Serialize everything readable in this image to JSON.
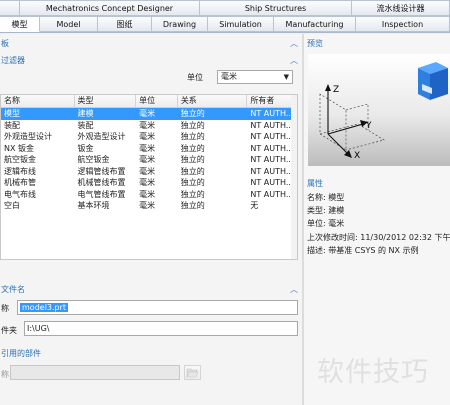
{
  "top_tabs": [
    {
      "label": "",
      "width": 0
    },
    {
      "label": "Mechatronics Concept Designer"
    },
    {
      "label": "Ship Structures"
    },
    {
      "label": "流水线设计器"
    }
  ],
  "app_tabs": [
    {
      "label": "模型",
      "active": true
    },
    {
      "label": "Model"
    },
    {
      "label": "图纸"
    },
    {
      "label": "Drawing"
    },
    {
      "label": "Simulation"
    },
    {
      "label": "Manufacturing"
    },
    {
      "label": "Inspection"
    }
  ],
  "templates": {
    "header": "板",
    "filter_header": "过滤器",
    "unit_label": "单位",
    "unit_value": "毫米",
    "columns": [
      "名称",
      "类型",
      "单位",
      "关系",
      "所有者"
    ],
    "rows": [
      [
        "模型",
        "建模",
        "毫米",
        "独立的",
        "NT AUTH..."
      ],
      [
        "装配",
        "装配",
        "毫米",
        "独立的",
        "NT AUTH..."
      ],
      [
        "外观造型设计",
        "外观造型设计",
        "毫米",
        "独立的",
        "NT AUTH..."
      ],
      [
        "NX 钣金",
        "钣金",
        "毫米",
        "独立的",
        "NT AUTH..."
      ],
      [
        "航空钣金",
        "航空钣金",
        "毫米",
        "独立的",
        "NT AUTH..."
      ],
      [
        "逻辑布线",
        "逻辑管线布置",
        "毫米",
        "独立的",
        "NT AUTH..."
      ],
      [
        "机械布管",
        "机械管线布置",
        "毫米",
        "独立的",
        "NT AUTH..."
      ],
      [
        "电气布线",
        "电气管线布置",
        "毫米",
        "独立的",
        "NT AUTH..."
      ],
      [
        "空白",
        "基本环境",
        "毫米",
        "独立的",
        "无"
      ]
    ]
  },
  "new_file": {
    "header": "文件名",
    "name_label": "称",
    "name_value": "model3.prt",
    "folder_label": "件夹",
    "folder_value": "I:\\UG\\"
  },
  "referenced_part": {
    "header": "引用的部件",
    "name_label": "称"
  },
  "preview": {
    "header": "预览",
    "axes": [
      "Z",
      "Y",
      "X"
    ]
  },
  "properties": {
    "header": "属性",
    "rows": [
      {
        "label": "名称:",
        "value": "模型"
      },
      {
        "label": "类型:",
        "value": "建模"
      },
      {
        "label": "单位:",
        "value": "毫米"
      },
      {
        "label": "上次修改时间:",
        "value": "11/30/2012 02:32 下午"
      },
      {
        "label": "描述:",
        "value": "带基准 CSYS 的 NX 示例"
      }
    ]
  },
  "watermark": "软件技巧",
  "colors": {
    "selection": "#3399ff",
    "section_header": "#2a6fb7"
  }
}
